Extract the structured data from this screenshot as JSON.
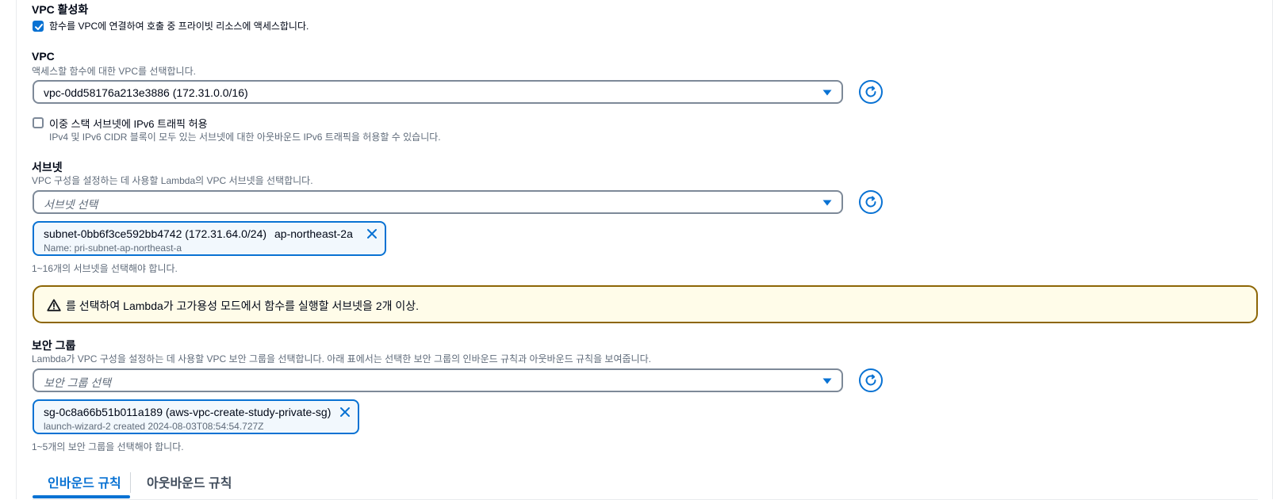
{
  "vpc_enable": {
    "title": "VPC 활성화",
    "checkbox_label": "함수를 VPC에 연결하여 호출 중 프라이빗 리소스에 액세스합니다.",
    "checked": true
  },
  "vpc": {
    "title": "VPC",
    "description": "액세스할 함수에 대한 VPC를 선택합니다.",
    "selected_value": "vpc-0dd58176a213e3886 (172.31.0.0/16)"
  },
  "ipv6": {
    "label": "이중 스택 서브넷에 IPv6 트래픽 허용",
    "description": "IPv4 및 IPv6 CIDR 블록이 모두 있는 서브넷에 대한 아웃바운드 IPv6 트래픽을 허용할 수 있습니다.",
    "checked": false
  },
  "subnets": {
    "title": "서브넷",
    "description": "VPC 구성을 설정하는 데 사용할 Lambda의 VPC 서브넷을 선택합니다.",
    "placeholder": "서브넷 선택",
    "token_main": "subnet-0bb6f3ce592bb4742 (172.31.64.0/24)",
    "token_az": "ap-northeast-2a",
    "token_sub": "Name: pri-subnet-ap-northeast-a",
    "constraint": "1~16개의 서브넷을 선택해야 합니다."
  },
  "alert": {
    "message": "를 선택하여 Lambda가 고가용성 모드에서 함수를 실행할 서브넷을 2개 이상."
  },
  "security_groups": {
    "title": "보안 그룹",
    "description": "Lambda가 VPC 구성을 설정하는 데 사용할 VPC 보안 그룹을 선택합니다. 아래 표에서는 선택한 보안 그룹의 인바운드 규칙과 아웃바운드 규칙을 보여줍니다.",
    "placeholder": "보안 그룹 선택",
    "token_main": "sg-0c8a66b51b011a189 (aws-vpc-create-study-private-sg)",
    "token_sub": "launch-wizard-2 created 2024-08-03T08:54:54.727Z",
    "constraint": "1~5개의 보안 그룹을 선택해야 합니다."
  },
  "tabs": [
    {
      "label": "인바운드 규칙",
      "active": true
    },
    {
      "label": "아웃바운드 규칙",
      "active": false
    }
  ],
  "colors": {
    "accent": "#0972d3",
    "warning_border": "#8d6605",
    "warning_bg": "#fffce9",
    "text_secondary": "#5f6b7a"
  }
}
